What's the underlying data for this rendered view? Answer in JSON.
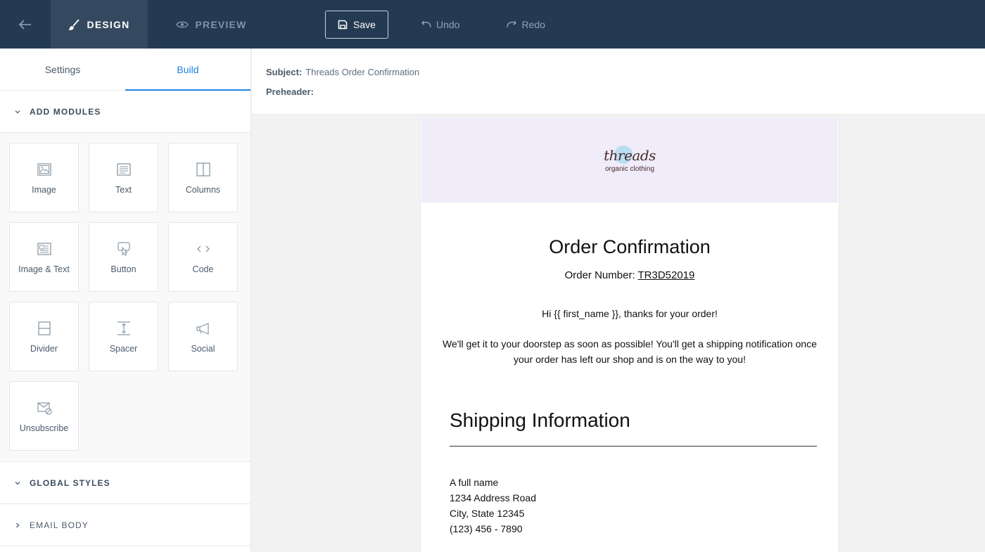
{
  "topbar": {
    "design_label": "DESIGN",
    "preview_label": "PREVIEW",
    "save_label": "Save",
    "undo_label": "Undo",
    "redo_label": "Redo"
  },
  "sidebar": {
    "tabs": [
      {
        "label": "Settings",
        "active": false
      },
      {
        "label": "Build",
        "active": true
      }
    ],
    "add_modules_label": "ADD MODULES",
    "modules": [
      {
        "label": "Image",
        "icon": "image-icon"
      },
      {
        "label": "Text",
        "icon": "text-icon"
      },
      {
        "label": "Columns",
        "icon": "columns-icon"
      },
      {
        "label": "Image & Text",
        "icon": "image-text-icon"
      },
      {
        "label": "Button",
        "icon": "button-icon"
      },
      {
        "label": "Code",
        "icon": "code-icon"
      },
      {
        "label": "Divider",
        "icon": "divider-icon"
      },
      {
        "label": "Spacer",
        "icon": "spacer-icon"
      },
      {
        "label": "Social",
        "icon": "megaphone-icon"
      },
      {
        "label": "Unsubscribe",
        "icon": "unsubscribe-icon"
      }
    ],
    "global_styles_label": "GLOBAL STYLES",
    "email_body_label": "EMAIL BODY"
  },
  "meta": {
    "subject_key": "Subject:",
    "subject_value": "Threads Order Confirmation",
    "preheader_key": "Preheader:",
    "preheader_value": ""
  },
  "email": {
    "logo_text": "threads",
    "logo_subtitle": "organic clothing",
    "title": "Order Confirmation",
    "order_number_label": "Order Number:",
    "order_number": "TR3D52019",
    "greeting": "Hi {{ first_name }}, thanks for your order!",
    "body": "We'll get it to your doorstep as soon as possible! You'll get a shipping notification once your order has left our shop and is on the way to you!",
    "shipping_title": "Shipping Information",
    "address_lines": [
      "A full name",
      "1234 Address Road",
      "City, State 12345",
      "(123) 456 - 7890"
    ]
  },
  "colors": {
    "topbar": "#243a52",
    "active_tab": "#1a82e2",
    "email_header": "#f0ecfa"
  }
}
